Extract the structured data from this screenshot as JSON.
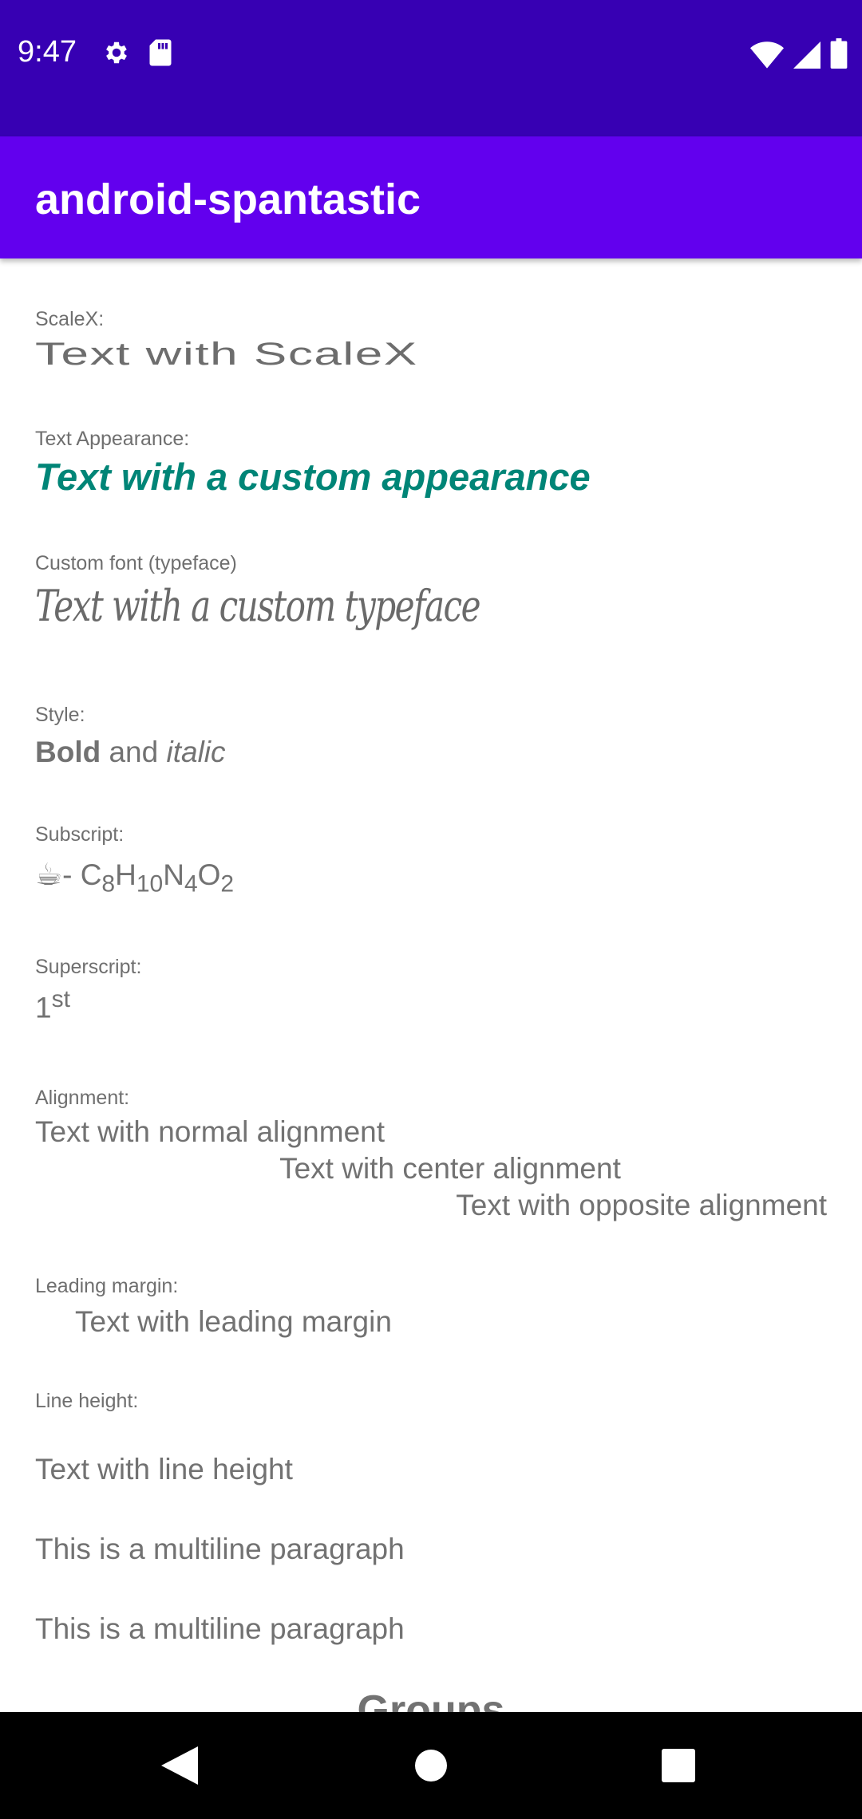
{
  "status_bar": {
    "time": "9:47",
    "left_icons": [
      "settings-icon",
      "sd-card-icon"
    ],
    "right_icons": [
      "wifi-icon",
      "signal-icon",
      "battery-icon"
    ]
  },
  "app_bar": {
    "title": "android-spantastic"
  },
  "sections": {
    "scalex": {
      "label": "ScaleX:",
      "value": "Text with ScaleX"
    },
    "appearance": {
      "label": "Text Appearance:",
      "value": "Text with a custom appearance",
      "color": "#008577"
    },
    "typeface": {
      "label": "Custom font (typeface)",
      "value": "Text with a custom typeface"
    },
    "style": {
      "label": "Style:",
      "bold": "Bold",
      "middle": " and ",
      "italic": "italic"
    },
    "subscript": {
      "label": "Subscript:",
      "emoji": "☕",
      "dash": "- ",
      "formula": [
        {
          "t": "C",
          "sub": "8"
        },
        {
          "t": "H",
          "sub": "10"
        },
        {
          "t": "N",
          "sub": "4"
        },
        {
          "t": "O",
          "sub": "2"
        }
      ]
    },
    "superscript": {
      "label": "Superscript:",
      "base": "1",
      "sup": "st"
    },
    "alignment": {
      "label": "Alignment:",
      "normal": "Text with normal alignment",
      "center": "Text with center alignment",
      "opposite": "Text with opposite alignment"
    },
    "leading_margin": {
      "label": "Leading margin:",
      "value": "Text with leading margin"
    },
    "line_height": {
      "label": "Line height:",
      "lines": [
        "Text with line height",
        "This is a multiline paragraph",
        "This is a multiline paragraph"
      ]
    },
    "groups": {
      "title": "Groups"
    }
  },
  "colors": {
    "status_bar": "#3700b3",
    "app_bar": "#6200ee",
    "accent": "#008577"
  },
  "nav_bar": {
    "buttons": [
      "back-icon",
      "home-icon",
      "recents-icon"
    ]
  }
}
